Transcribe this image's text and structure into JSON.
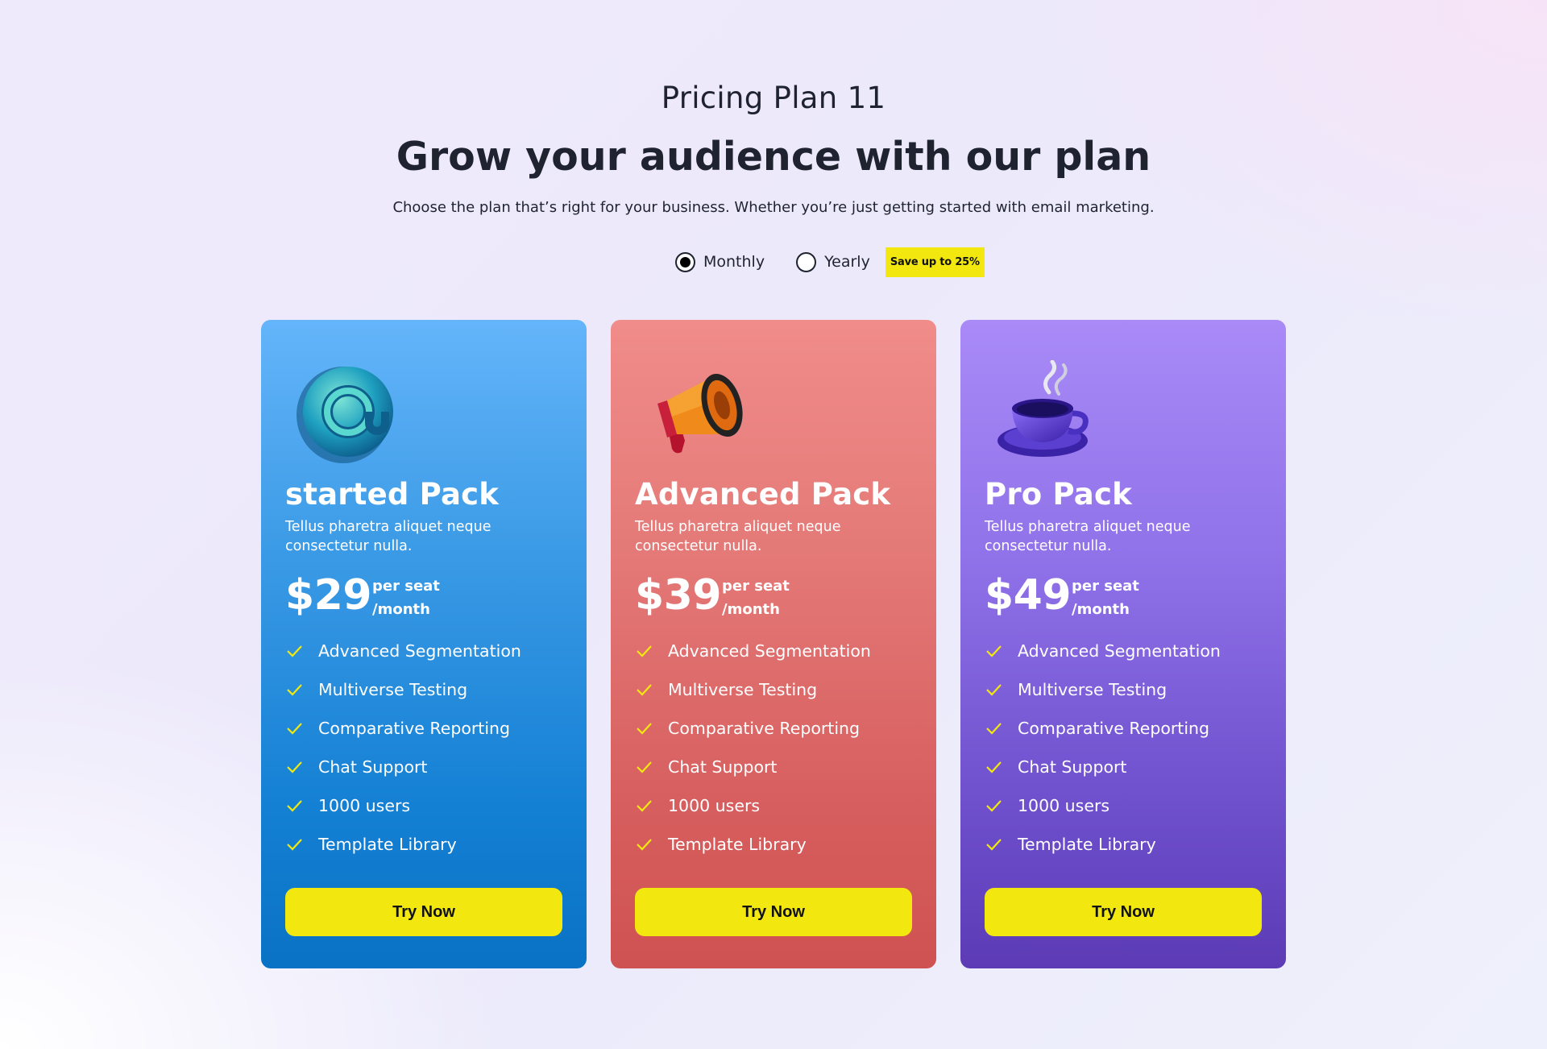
{
  "header": {
    "eyebrow": "Pricing Plan 11",
    "headline": "Grow your audience with our plan",
    "subline": "Choose the plan that’s right for your business. Whether you’re just getting started with email marketing."
  },
  "billing_toggle": {
    "monthly_label": "Monthly",
    "yearly_label": "Yearly",
    "selected": "Monthly",
    "save_badge": "Save up to 25%"
  },
  "colors": {
    "accent_yellow": "#f2e80f",
    "card_blue": "#3c9be6",
    "card_red": "#e47a78",
    "card_purple": "#9173ea",
    "check_yellow": "#f2e80f"
  },
  "plans": [
    {
      "icon": "at-sign-icon",
      "title": "started Pack",
      "description": "Tellus pharetra aliquet neque consectetur nulla.",
      "price": "$29",
      "per_seat": "per seat",
      "per_month": "/month",
      "features": [
        "Advanced Segmentation",
        "Multiverse Testing",
        "Comparative Reporting",
        "Chat Support",
        "1000 users",
        "Template Library"
      ],
      "button_label": "Try Now"
    },
    {
      "icon": "megaphone-icon",
      "title": "Advanced Pack",
      "description": "Tellus pharetra aliquet neque consectetur nulla.",
      "price": "$39",
      "per_seat": "per seat",
      "per_month": "/month",
      "features": [
        "Advanced Segmentation",
        "Multiverse Testing",
        "Comparative Reporting",
        "Chat Support",
        "1000 users",
        "Template Library"
      ],
      "button_label": "Try Now"
    },
    {
      "icon": "coffee-cup-icon",
      "title": "Pro Pack",
      "description": "Tellus pharetra aliquet neque consectetur nulla.",
      "price": "$49",
      "per_seat": "per seat",
      "per_month": "/month",
      "features": [
        "Advanced Segmentation",
        "Multiverse Testing",
        "Comparative Reporting",
        "Chat Support",
        "1000 users",
        "Template Library"
      ],
      "button_label": "Try Now"
    }
  ]
}
